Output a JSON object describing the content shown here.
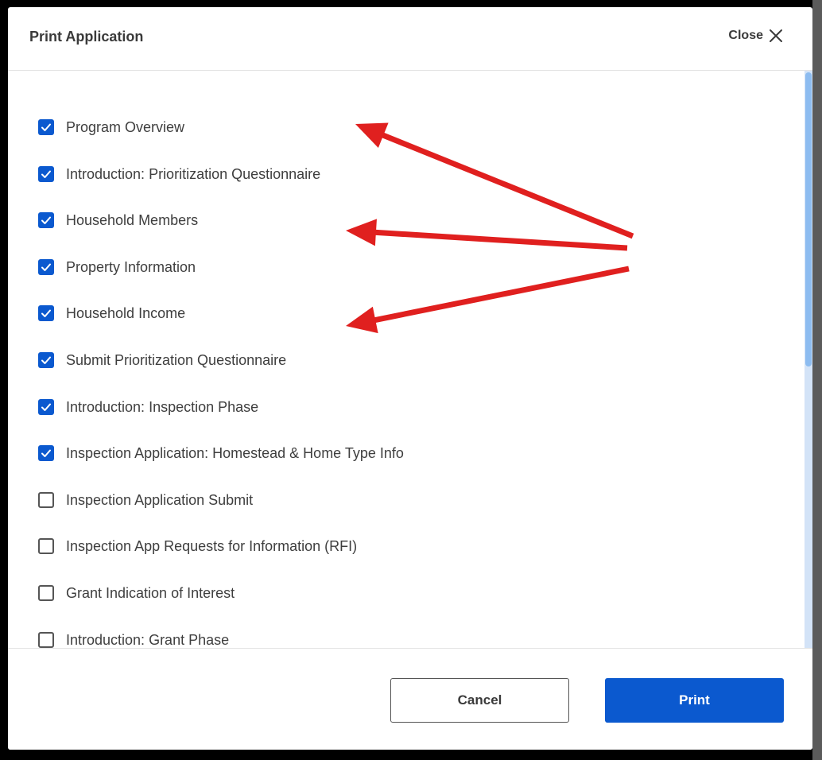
{
  "modal": {
    "title": "Print Application",
    "close_label": "Close"
  },
  "options": [
    {
      "label": "Program Overview",
      "checked": true
    },
    {
      "label": "Introduction: Prioritization Questionnaire",
      "checked": true
    },
    {
      "label": "Household Members",
      "checked": true
    },
    {
      "label": "Property Information",
      "checked": true
    },
    {
      "label": "Household Income",
      "checked": true
    },
    {
      "label": "Submit Prioritization Questionnaire",
      "checked": true
    },
    {
      "label": "Introduction: Inspection Phase",
      "checked": true
    },
    {
      "label": "Inspection Application: Homestead & Home Type Info",
      "checked": true
    },
    {
      "label": "Inspection Application Submit",
      "checked": false
    },
    {
      "label": "Inspection App Requests for Information (RFI)",
      "checked": false
    },
    {
      "label": "Grant Indication of Interest",
      "checked": false
    },
    {
      "label": "Introduction: Grant Phase",
      "checked": false
    }
  ],
  "footer": {
    "cancel_label": "Cancel",
    "print_label": "Print"
  },
  "colors": {
    "accent": "#0b59cf",
    "annotation_arrow": "#e0201f"
  },
  "icons": {
    "close": "close-icon",
    "check": "checkmark-icon"
  }
}
